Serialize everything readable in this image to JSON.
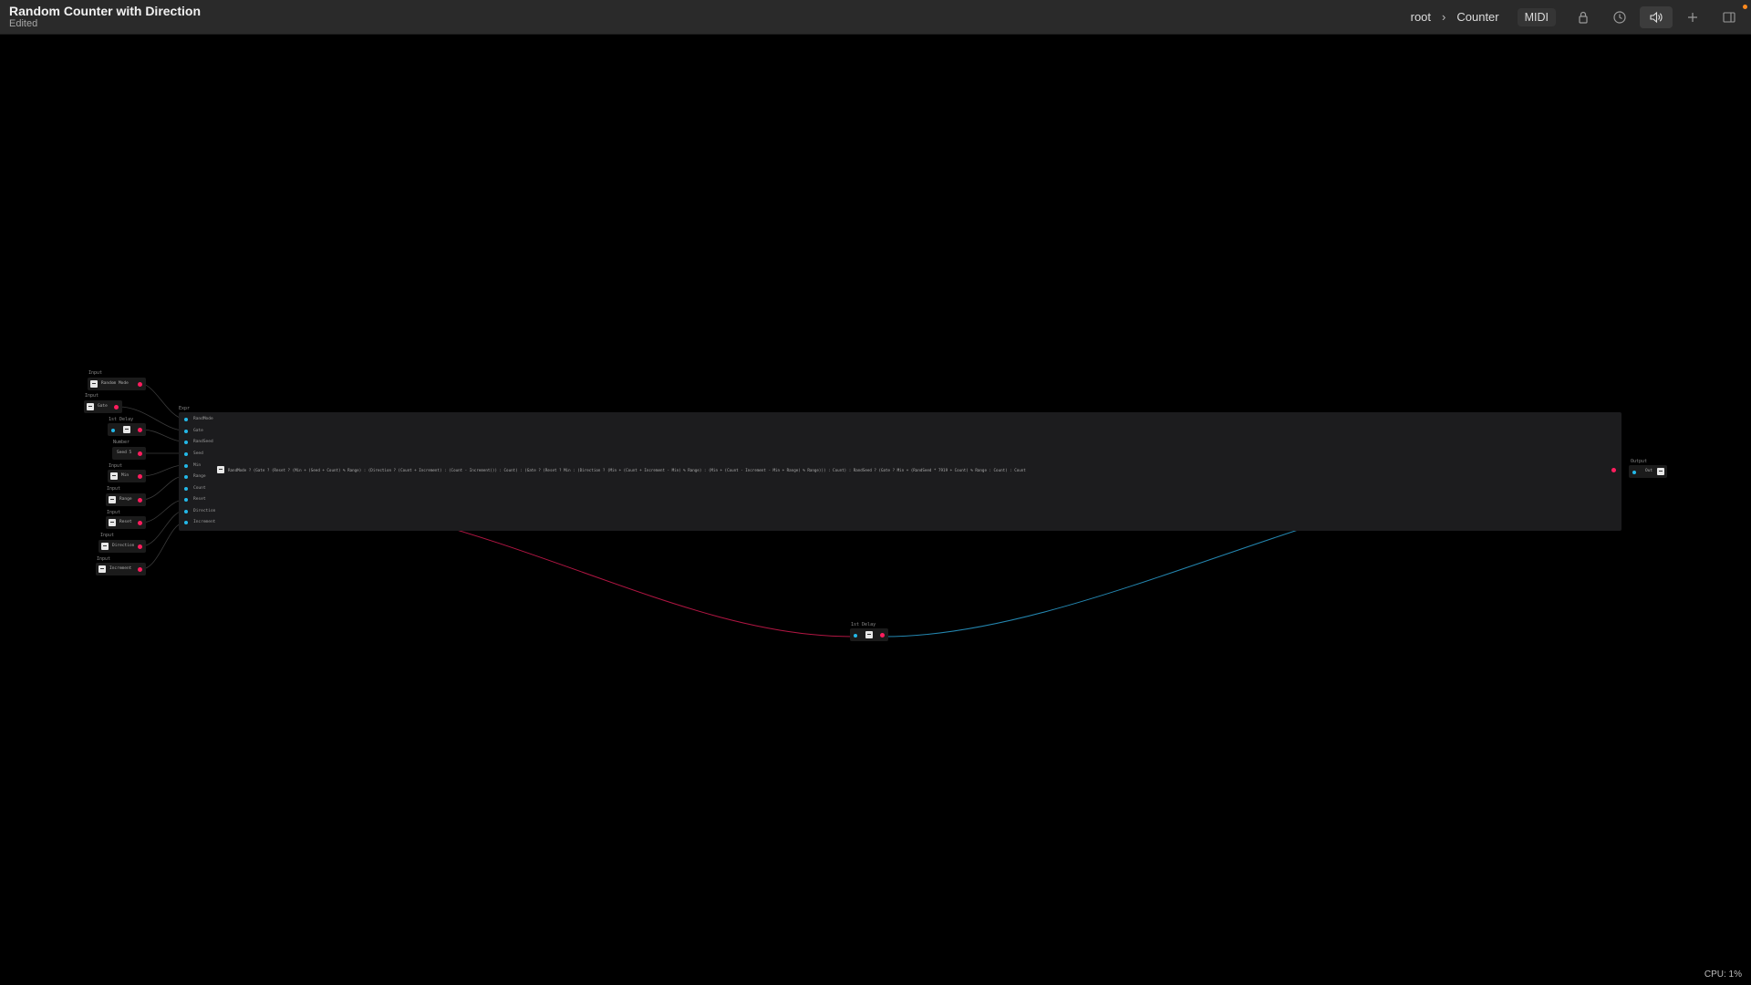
{
  "titlebar": {
    "title": "Random Counter with Direction",
    "status": "Edited",
    "breadcrumb": [
      "root",
      "Counter"
    ],
    "breadcrumb_separator": "›",
    "midi_label": "MIDI",
    "icons": [
      "lock-icon",
      "history-icon",
      "speaker-icon",
      "plus-icon",
      "sidebar-icon"
    ],
    "notification_color": "#ff8a1e"
  },
  "colors": {
    "output_port": "#ff1d5e",
    "input_port": "#23b8e8",
    "wire_red": "#d01a4f",
    "wire_blue": "#2a9fd0"
  },
  "canvas": {
    "input_nodes": [
      {
        "label": "Input",
        "text": "Random Mode"
      },
      {
        "label": "Input",
        "text": "Gate"
      },
      {
        "label": "1st Delay",
        "text": ""
      },
      {
        "label": "Number",
        "text": "Seed 5"
      },
      {
        "label": "Input",
        "text": "Min"
      },
      {
        "label": "Input",
        "text": "Range"
      },
      {
        "label": "Input",
        "text": "Reset"
      },
      {
        "label": "Input",
        "text": "Direction"
      },
      {
        "label": "Input",
        "text": "Increment"
      }
    ],
    "script_node": {
      "label": "Expr",
      "inputs": [
        "RandMode",
        "Gate",
        "RandSeed",
        "Seed",
        "Min",
        "Range",
        "Count",
        "Reset",
        "Direction",
        "Increment"
      ],
      "code": "RandMode ? (Gate ? (Reset ? (Min + (Seed + Count) % Range) : (Direction ? (Count + Increment) : (Count - Increment))) : Count) : (Gate ? (Reset ? Min : (Direction ? (Min + (Count + Increment - Min) % Range) : (Min + (Count - Increment - Min + Range) % Range))) : Count) : RandSeed ? (Gate ? Min + (RandSeed * 7919 + Count) % Range : Count) : Count"
    },
    "delay_node": {
      "label": "1st Delay"
    },
    "output_node": {
      "label": "Output",
      "text": "Out"
    }
  },
  "status": {
    "cpu": "CPU: 1%"
  }
}
